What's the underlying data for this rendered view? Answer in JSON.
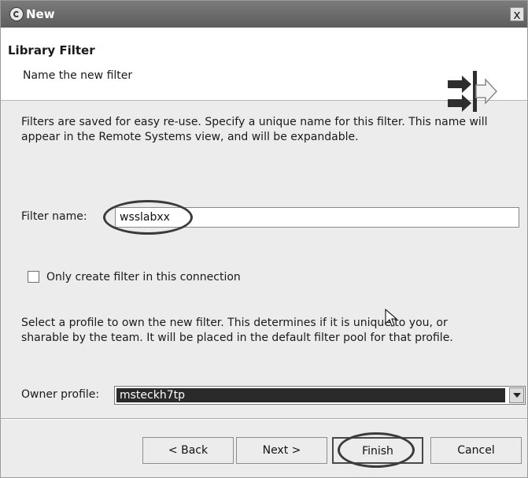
{
  "window": {
    "title": "New",
    "close_symbol": "x"
  },
  "banner": {
    "title": "Library Filter",
    "subtitle": "Name the new filter",
    "icon": "wizard-arrows-icon"
  },
  "description": {
    "line1": "Filters are saved for easy re-use. Specify a unique name for this filter. This name will",
    "line2": "appear in the Remote Systems view, and will be expandable."
  },
  "filter_name": {
    "label": "Filter name:",
    "value": "wsslabxx"
  },
  "only_connection": {
    "label": "Only create filter in this connection",
    "checked": false
  },
  "profile_desc": {
    "line1": "Select a profile to own the new filter. This determines if it is unique to you, or",
    "line2": "sharable by the team. It will be placed in the default filter pool for that profile."
  },
  "owner_profile": {
    "label": "Owner profile:",
    "value": "msteckh7tp"
  },
  "buttons": {
    "back": "< Back",
    "next": "Next >",
    "finish": "Finish",
    "cancel": "Cancel"
  }
}
